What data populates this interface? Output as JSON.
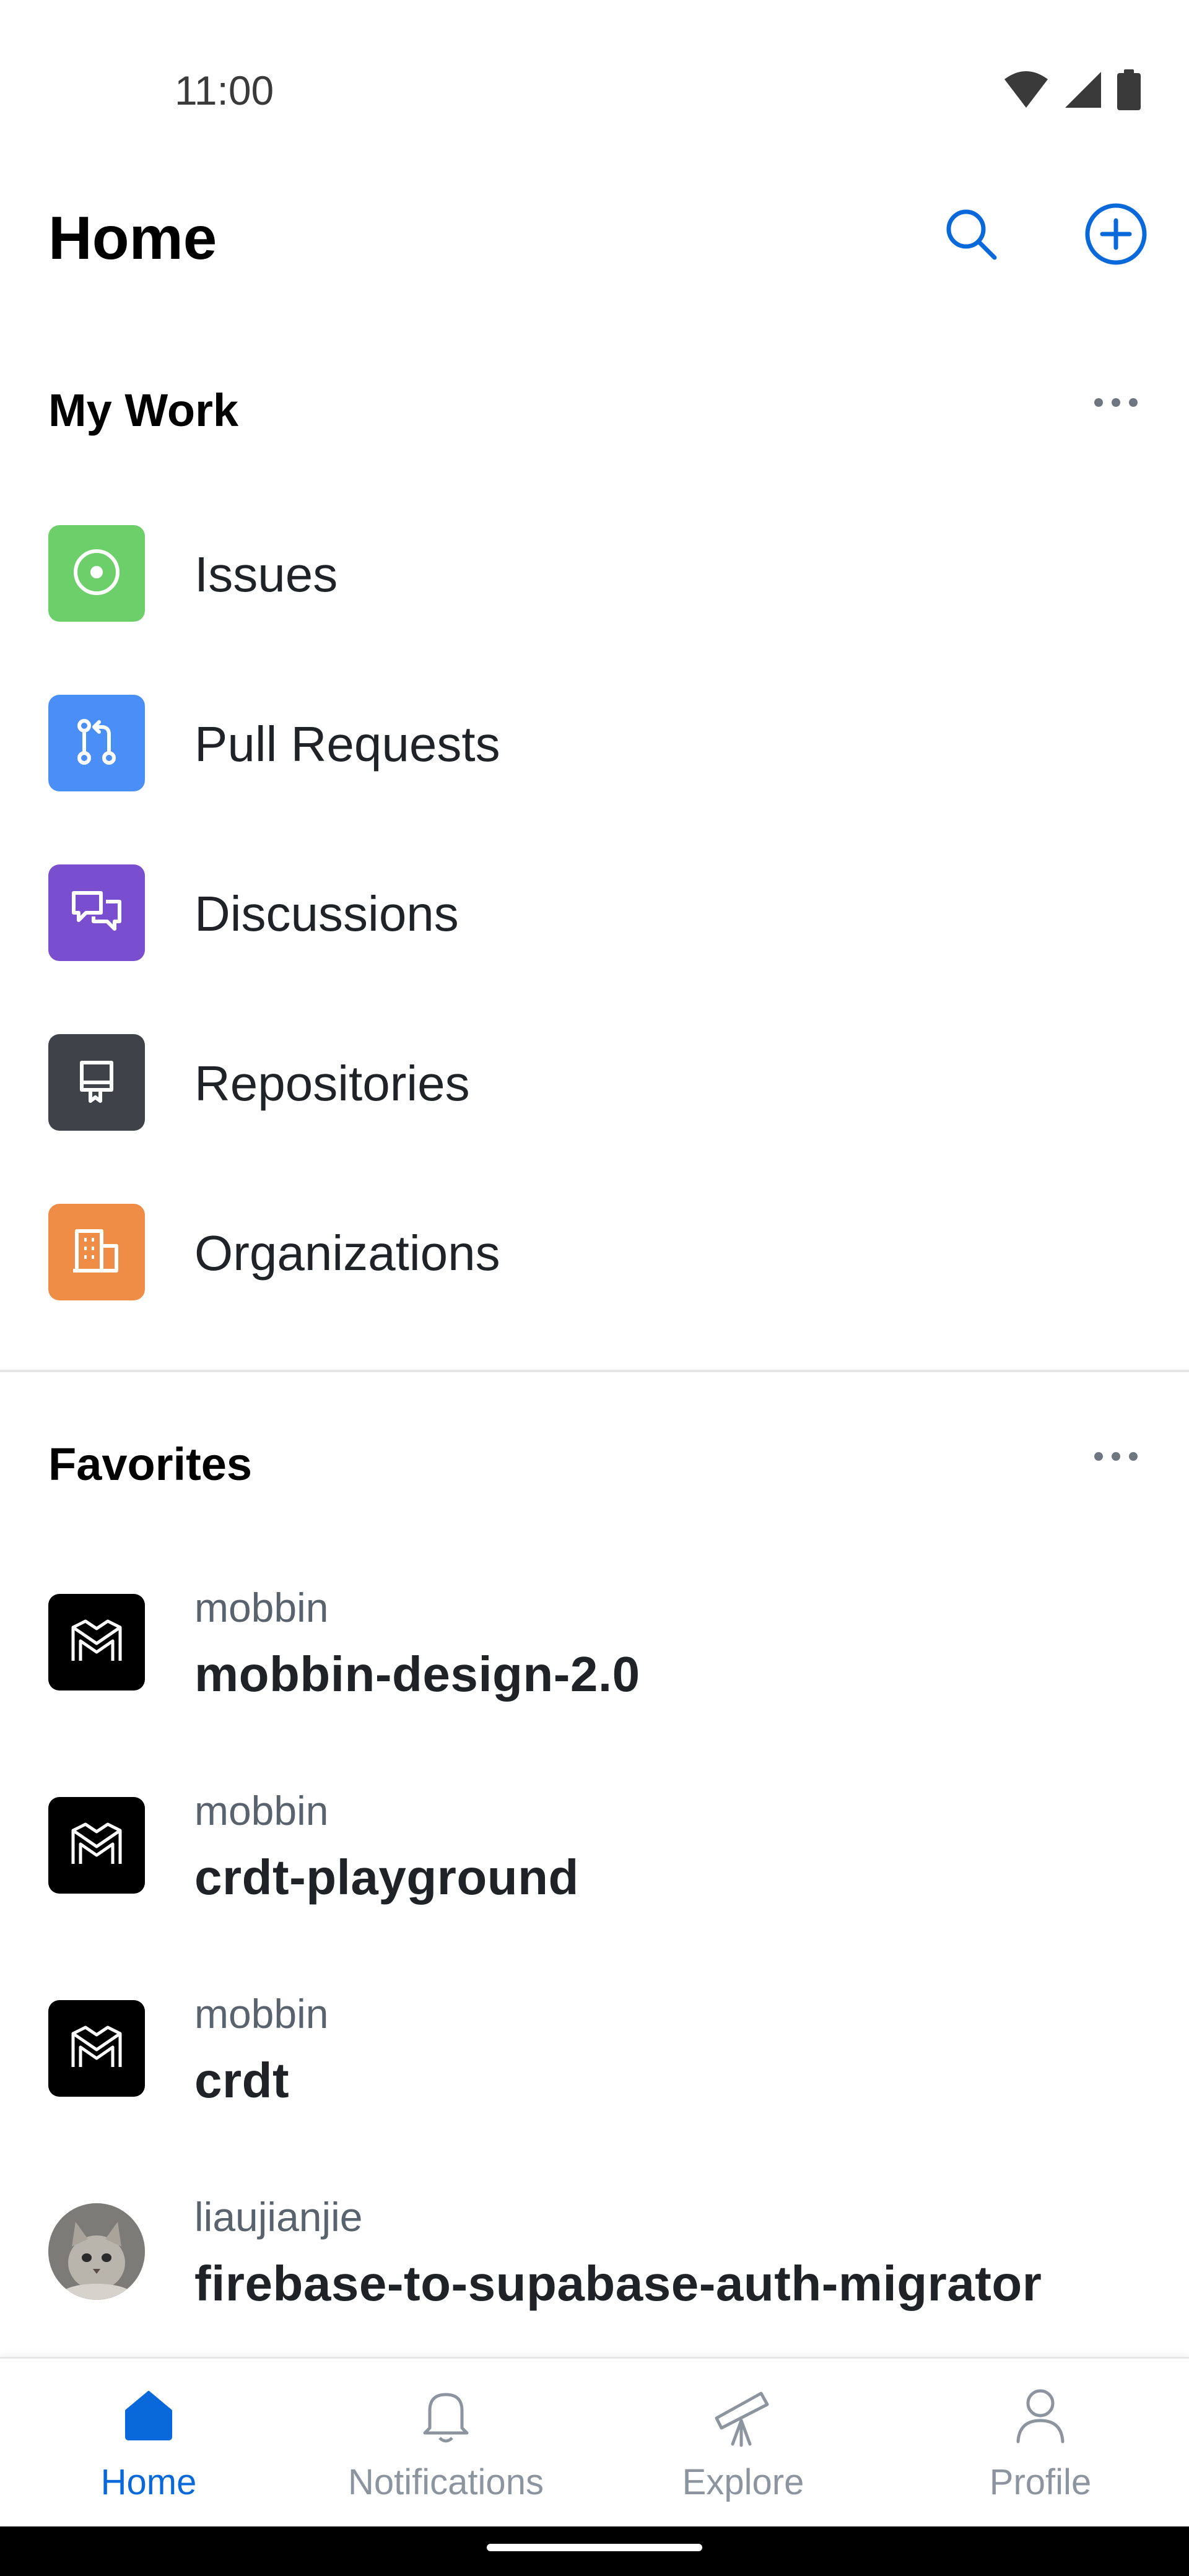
{
  "status_bar": {
    "time": "11:00"
  },
  "header": {
    "title": "Home"
  },
  "my_work": {
    "title": "My Work",
    "items": [
      {
        "label": "Issues",
        "icon": "issue-opened-icon",
        "color": "#6ccf6a"
      },
      {
        "label": "Pull Requests",
        "icon": "git-pull-request-icon",
        "color": "#4a8ef7"
      },
      {
        "label": "Discussions",
        "icon": "comment-discussion-icon",
        "color": "#7a4fcf"
      },
      {
        "label": "Repositories",
        "icon": "repo-icon",
        "color": "#3f4349"
      },
      {
        "label": "Organizations",
        "icon": "organization-icon",
        "color": "#ef8c45"
      }
    ]
  },
  "favorites": {
    "title": "Favorites",
    "items": [
      {
        "owner": "mobbin",
        "name": "mobbin-design-2.0"
      },
      {
        "owner": "mobbin",
        "name": "crdt-playground"
      },
      {
        "owner": "mobbin",
        "name": "crdt"
      },
      {
        "owner": "liaujianjie",
        "name": "firebase-to-supabase-auth-migrator"
      }
    ]
  },
  "bottom_nav": {
    "items": [
      {
        "label": "Home",
        "icon": "home-icon",
        "active": true
      },
      {
        "label": "Notifications",
        "icon": "bell-icon",
        "active": false
      },
      {
        "label": "Explore",
        "icon": "telescope-icon",
        "active": false
      },
      {
        "label": "Profile",
        "icon": "person-icon",
        "active": false
      }
    ]
  },
  "colors": {
    "accent": "#0969da",
    "text_primary": "#1f2328",
    "text_secondary": "#59636e",
    "nav_inactive": "#8c959f"
  }
}
